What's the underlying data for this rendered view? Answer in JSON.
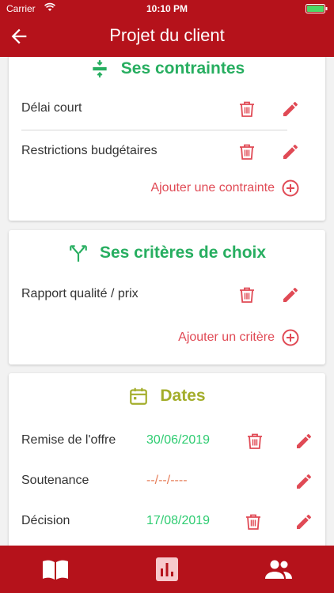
{
  "statusbar": {
    "carrier": "Carrier",
    "time": "10:10 PM"
  },
  "navbar": {
    "title": "Projet du client"
  },
  "constraints": {
    "title": "Ses contraintes",
    "items": [
      "Délai court",
      "Restrictions budgétaires"
    ],
    "add_label": "Ajouter une contrainte"
  },
  "criteria": {
    "title": "Ses critères de choix",
    "items": [
      "Rapport qualité / prix"
    ],
    "add_label": "Ajouter un critère"
  },
  "dates": {
    "title": "Dates",
    "rows": [
      {
        "label": "Remise de l'offre",
        "value": "30/06/2019"
      },
      {
        "label": "Soutenance",
        "value": "--/--/----"
      },
      {
        "label": "Décision",
        "value": "17/08/2019"
      }
    ]
  },
  "colors": {
    "header": "#b5121b",
    "green_title": "#27ae60",
    "olive_title": "#a3ad2a",
    "action_red": "#e04a55",
    "date_green": "#2ecc71",
    "date_empty": "#e67e5a"
  },
  "icons": {
    "back": "arrow-left-icon",
    "constraints": "compress-icon",
    "criteria": "merge-arrows-icon",
    "dates": "calendar-icon",
    "delete": "trash-icon",
    "edit": "pencil-icon",
    "add": "circle-plus-icon",
    "tab1": "book-icon",
    "tab2": "bar-chart-icon",
    "tab3": "people-icon"
  }
}
